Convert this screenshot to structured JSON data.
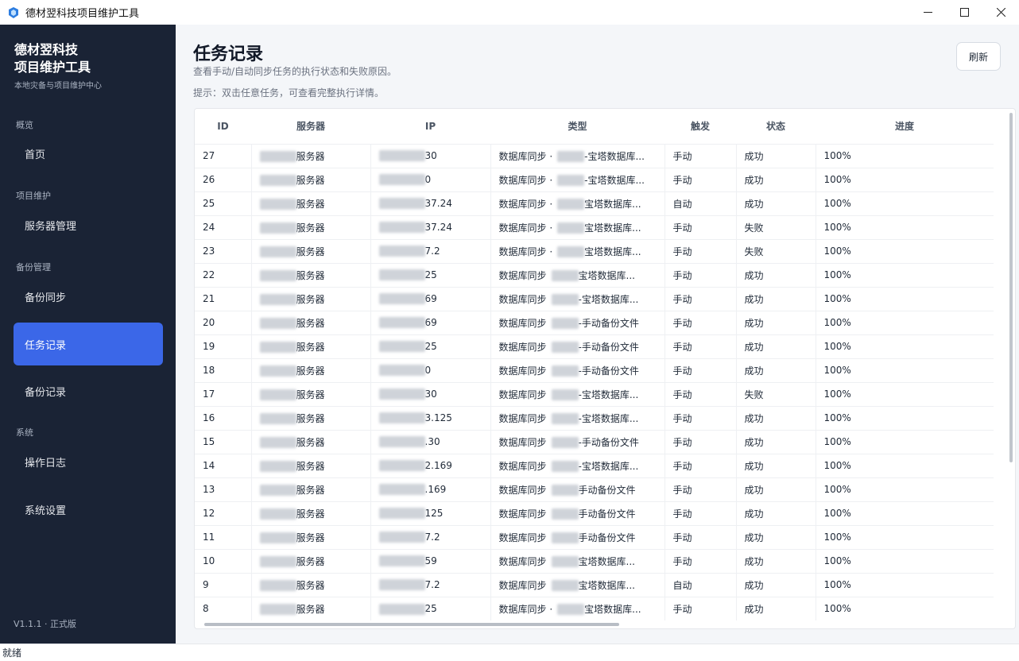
{
  "window": {
    "title": "德材翌科技项目维护工具"
  },
  "sidebar": {
    "brand_line1": "德材翌科技",
    "brand_line2": "项目维护工具",
    "brand_sub": "本地灾备与项目维护中心",
    "sections": {
      "overview": "概览",
      "project": "项目维护",
      "backup": "备份管理",
      "system": "系统"
    },
    "items": {
      "home": "首页",
      "servers": "服务器管理",
      "backup_sync": "备份同步",
      "tasks": "任务记录",
      "backup_records": "备份记录",
      "logs": "操作日志",
      "settings": "系统设置"
    },
    "version": "V1.1.1 · 正式版"
  },
  "main": {
    "title": "任务记录",
    "description": "查看手动/自动同步任务的执行状态和失败原因。",
    "hint": "提示：双击任意任务，可查看完整执行详情。",
    "refresh_label": "刷新"
  },
  "table": {
    "headers": [
      "ID",
      "服务器",
      "IP",
      "类型",
      "触发",
      "状态",
      "进度"
    ],
    "rows": [
      {
        "id": "27",
        "server": "服务器",
        "ip_tail": "30",
        "type_prefix": "数据库同步 ·",
        "type_suffix": "-宝塔数据库...",
        "trigger": "手动",
        "status": "成功",
        "progress": "100%"
      },
      {
        "id": "26",
        "server": "服务器",
        "ip_tail": "0",
        "type_prefix": "数据库同步 ·",
        "type_suffix": "-宝塔数据库...",
        "trigger": "手动",
        "status": "成功",
        "progress": "100%"
      },
      {
        "id": "25",
        "server": "服务器",
        "ip_tail": "37.24",
        "type_prefix": "数据库同步 ·",
        "type_suffix": "宝塔数据库...",
        "trigger": "自动",
        "status": "成功",
        "progress": "100%"
      },
      {
        "id": "24",
        "server": "服务器",
        "ip_tail": "37.24",
        "type_prefix": "数据库同步 ·",
        "type_suffix": "宝塔数据库...",
        "trigger": "手动",
        "status": "失败",
        "progress": "100%"
      },
      {
        "id": "23",
        "server": "服务器",
        "ip_tail": "7.2",
        "type_prefix": "数据库同步 ·",
        "type_suffix": "宝塔数据库...",
        "trigger": "手动",
        "status": "失败",
        "progress": "100%"
      },
      {
        "id": "22",
        "server": "服务器",
        "ip_tail": "25",
        "type_prefix": "数据库同步",
        "type_suffix": "宝塔数据库...",
        "trigger": "手动",
        "status": "成功",
        "progress": "100%"
      },
      {
        "id": "21",
        "server": "服务器",
        "ip_tail": "69",
        "type_prefix": "数据库同步",
        "type_suffix": "-宝塔数据库...",
        "trigger": "手动",
        "status": "成功",
        "progress": "100%"
      },
      {
        "id": "20",
        "server": "服务器",
        "ip_tail": "69",
        "type_prefix": "数据库同步",
        "type_suffix": "-手动备份文件",
        "trigger": "手动",
        "status": "成功",
        "progress": "100%"
      },
      {
        "id": "19",
        "server": "服务器",
        "ip_tail": "25",
        "type_prefix": "数据库同步",
        "type_suffix": "-手动备份文件",
        "trigger": "手动",
        "status": "成功",
        "progress": "100%"
      },
      {
        "id": "18",
        "server": "服务器",
        "ip_tail": "0",
        "type_prefix": "数据库同步",
        "type_suffix": "-手动备份文件",
        "trigger": "手动",
        "status": "成功",
        "progress": "100%"
      },
      {
        "id": "17",
        "server": "服务器",
        "ip_tail": "30",
        "type_prefix": "数据库同步",
        "type_suffix": "-宝塔数据库...",
        "trigger": "手动",
        "status": "失败",
        "progress": "100%"
      },
      {
        "id": "16",
        "server": "服务器",
        "ip_tail": "3.125",
        "type_prefix": "数据库同步",
        "type_suffix": "-宝塔数据库...",
        "trigger": "手动",
        "status": "成功",
        "progress": "100%"
      },
      {
        "id": "15",
        "server": "服务器",
        "ip_tail": ".30",
        "type_prefix": "数据库同步",
        "type_suffix": "-手动备份文件",
        "trigger": "手动",
        "status": "成功",
        "progress": "100%"
      },
      {
        "id": "14",
        "server": "服务器",
        "ip_tail": "2.169",
        "type_prefix": "数据库同步",
        "type_suffix": "-宝塔数据库...",
        "trigger": "手动",
        "status": "成功",
        "progress": "100%"
      },
      {
        "id": "13",
        "server": "服务器",
        "ip_tail": ".169",
        "type_prefix": "数据库同步",
        "type_suffix": "手动备份文件",
        "trigger": "手动",
        "status": "成功",
        "progress": "100%"
      },
      {
        "id": "12",
        "server": "服务器",
        "ip_tail": "125",
        "type_prefix": "数据库同步",
        "type_suffix": "手动备份文件",
        "trigger": "手动",
        "status": "成功",
        "progress": "100%"
      },
      {
        "id": "11",
        "server": "服务器",
        "ip_tail": "7.2",
        "type_prefix": "数据库同步",
        "type_suffix": "手动备份文件",
        "trigger": "手动",
        "status": "成功",
        "progress": "100%"
      },
      {
        "id": "10",
        "server": "服务器",
        "ip_tail": "59",
        "type_prefix": "数据库同步",
        "type_suffix": "宝塔数据库...",
        "trigger": "手动",
        "status": "成功",
        "progress": "100%"
      },
      {
        "id": "9",
        "server": "服务器",
        "ip_tail": "7.2",
        "type_prefix": "数据库同步",
        "type_suffix": "宝塔数据库...",
        "trigger": "自动",
        "status": "成功",
        "progress": "100%"
      },
      {
        "id": "8",
        "server": "服务器",
        "ip_tail": "25",
        "type_prefix": "数据库同步 ·",
        "type_suffix": "宝塔数据库...",
        "trigger": "手动",
        "status": "成功",
        "progress": "100%"
      }
    ]
  },
  "statusbar": {
    "text": "就绪"
  },
  "colors": {
    "sidebar_bg": "#1a2335",
    "accent": "#3b67e8",
    "main_bg": "#f4f6f9"
  }
}
